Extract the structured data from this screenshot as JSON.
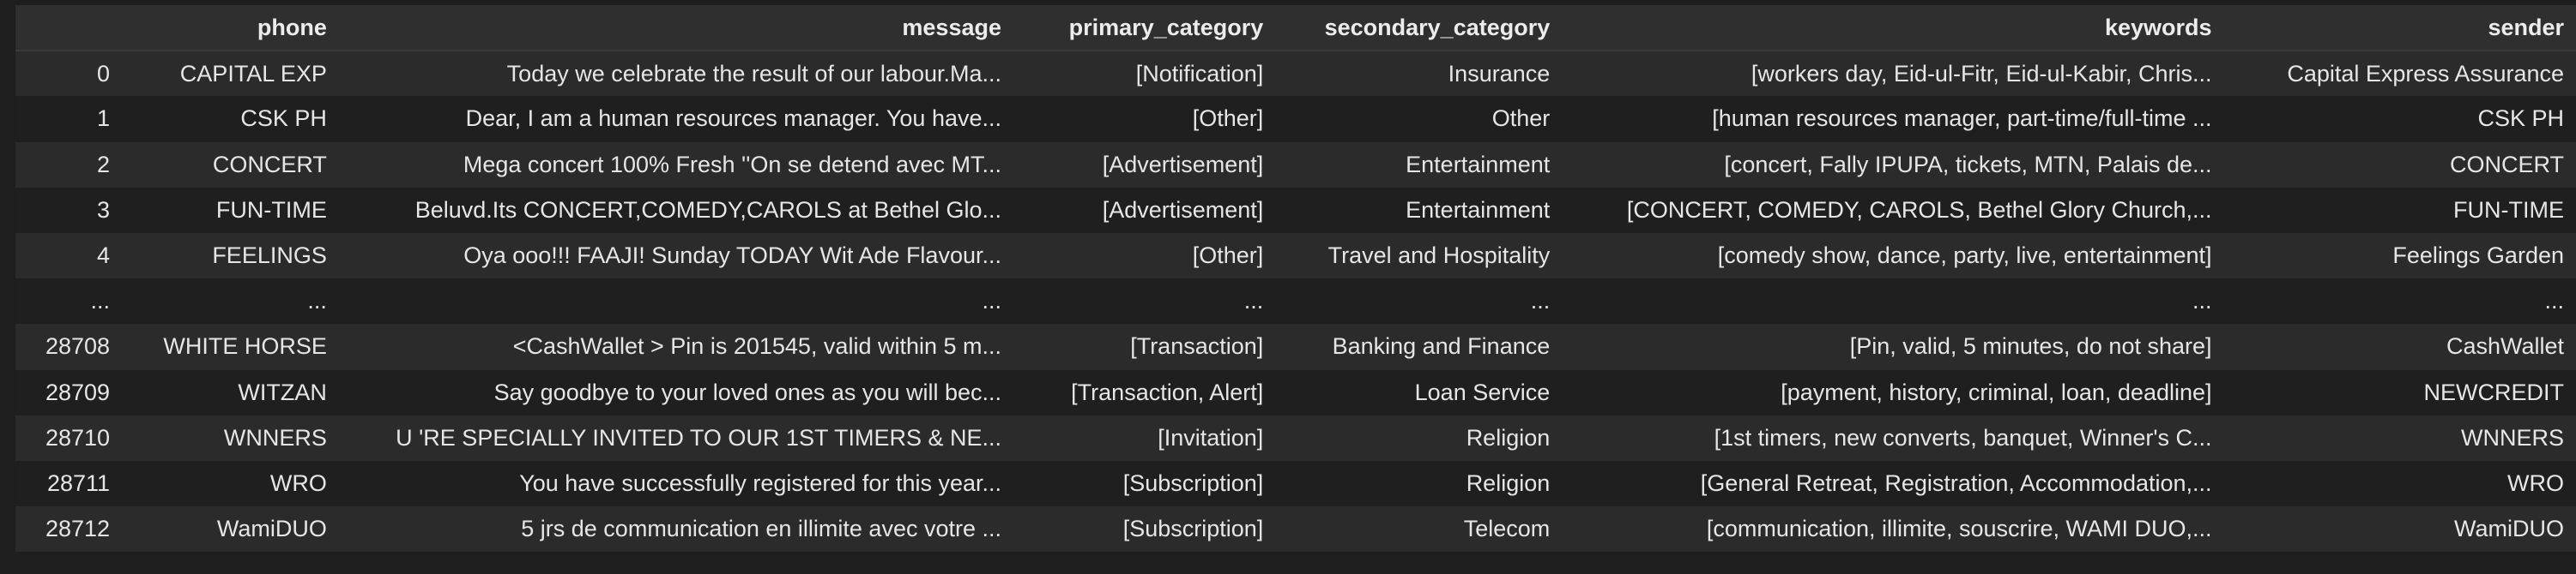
{
  "columns": [
    "",
    "phone",
    "message",
    "primary_category",
    "secondary_category",
    "keywords",
    "sender"
  ],
  "rows": [
    [
      "0",
      "CAPITAL EXP",
      "Today we celebrate the result of our labour.Ma...",
      "[Notification]",
      "Insurance",
      "[workers day, Eid-ul-Fitr, Eid-ul-Kabir, Chris...",
      "Capital Express Assurance"
    ],
    [
      "1",
      "CSK PH",
      "Dear, I am a human resources manager. You have...",
      "[Other]",
      "Other",
      "[human resources manager, part-time/full-time ...",
      "CSK PH"
    ],
    [
      "2",
      "CONCERT",
      "Mega concert 100% Fresh ''On se detend avec MT...",
      "[Advertisement]",
      "Entertainment",
      "[concert, Fally IPUPA, tickets, MTN, Palais de...",
      "CONCERT"
    ],
    [
      "3",
      "FUN-TIME",
      "Beluvd.Its CONCERT,COMEDY,CAROLS at Bethel Glo...",
      "[Advertisement]",
      "Entertainment",
      "[CONCERT, COMEDY, CAROLS, Bethel Glory Church,...",
      "FUN-TIME"
    ],
    [
      "4",
      "FEELINGS",
      "Oya ooo!!! FAAJI! Sunday TODAY Wit Ade Flavour...",
      "[Other]",
      "Travel and Hospitality",
      "[comedy show, dance, party, live, entertainment]",
      "Feelings Garden"
    ],
    [
      "...",
      "...",
      "...",
      "...",
      "...",
      "...",
      "..."
    ],
    [
      "28708",
      "WHITE HORSE",
      "<CashWallet > Pin is 201545, valid within 5 m...",
      "[Transaction]",
      "Banking and Finance",
      "[Pin, valid, 5 minutes, do not share]",
      "CashWallet"
    ],
    [
      "28709",
      "WITZAN",
      "Say goodbye to your loved ones as you will bec...",
      "[Transaction, Alert]",
      "Loan Service",
      "[payment, history, criminal, loan, deadline]",
      "NEWCREDIT"
    ],
    [
      "28710",
      "WNNERS",
      "U 'RE SPECIALLY INVITED TO OUR 1ST TIMERS & NE...",
      "[Invitation]",
      "Religion",
      "[1st timers, new converts, banquet, Winner's C...",
      "WNNERS"
    ],
    [
      "28711",
      "WRO",
      "You have successfully registered for this year...",
      "[Subscription]",
      "Religion",
      "[General Retreat, Registration, Accommodation,...",
      "WRO"
    ],
    [
      "28712",
      "WamiDUO",
      "5 jrs de communication en illimite avec votre ...",
      "[Subscription]",
      "Telecom",
      "[communication, illimite, souscrire, WAMI DUO,...",
      "WamiDUO"
    ]
  ]
}
